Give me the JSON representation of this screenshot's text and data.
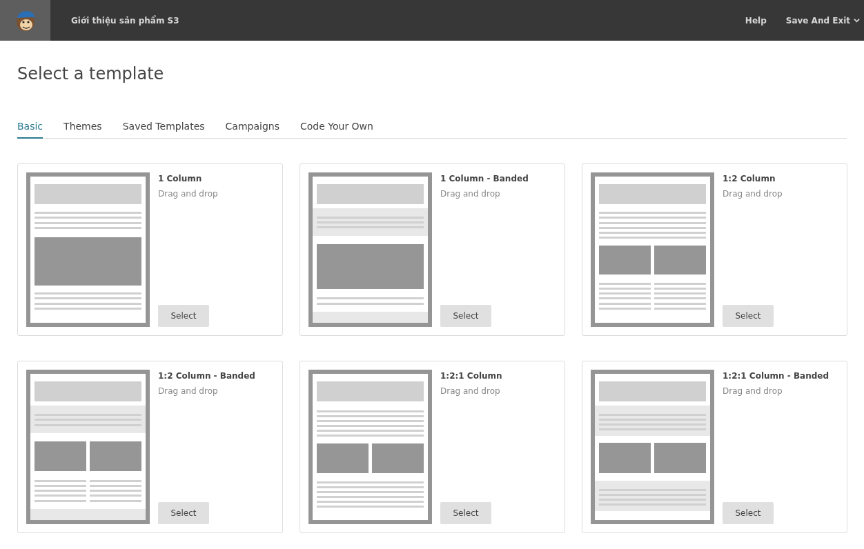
{
  "header": {
    "project_title": "Giới thiệu sản phẩm S3",
    "help": "Help",
    "save_menu": "Save And Exit"
  },
  "page_title": "Select a template",
  "tabs": [
    {
      "label": "Basic",
      "selected": true
    },
    {
      "label": "Themes",
      "selected": false
    },
    {
      "label": "Saved Templates",
      "selected": false
    },
    {
      "label": "Campaigns",
      "selected": false
    },
    {
      "label": "Code Your Own",
      "selected": false
    }
  ],
  "templates": [
    {
      "kind": "one-column",
      "name": "1 Column",
      "description": "Drag and drop",
      "button": "Select"
    },
    {
      "kind": "one-column-banded",
      "name": "1 Column - Banded",
      "description": "Drag and drop",
      "button": "Select"
    },
    {
      "kind": "one-two-column",
      "name": "1:2 Column",
      "description": "Drag and drop",
      "button": "Select"
    },
    {
      "kind": "one-two-column-banded",
      "name": "1:2 Column - Banded",
      "description": "Drag and drop",
      "button": "Select"
    },
    {
      "kind": "one-two-one-column",
      "name": "1:2:1 Column",
      "description": "Drag and drop",
      "button": "Select"
    },
    {
      "kind": "one-two-one-column-banded",
      "name": "1:2:1 Column - Banded",
      "description": "Drag and drop",
      "button": "Select"
    }
  ]
}
